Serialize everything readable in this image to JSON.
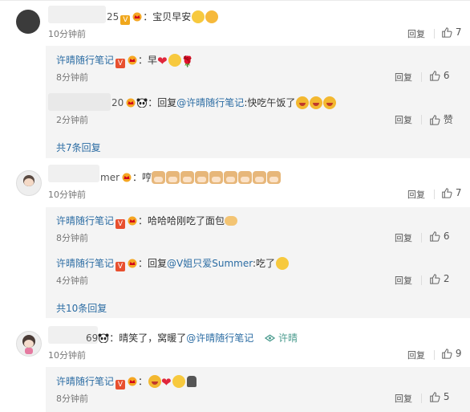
{
  "comments": [
    {
      "name_suffix": "25",
      "text": "：宝贝早安",
      "time": "10分钟前",
      "reply": "回复",
      "likes": "7",
      "replies": [
        {
          "name": "许晴随行笔记",
          "text": "：早",
          "time": "8分钟前",
          "reply": "回复",
          "likes": "6"
        },
        {
          "name_suffix": "20",
          "prefix": "：回复",
          "mention": "@许晴随行笔记",
          "text": ":快吃午饭了",
          "time": "2分钟前",
          "reply": "回复",
          "likes": "赞"
        }
      ],
      "more": "共7条回复"
    },
    {
      "name_suffix": "mer",
      "text": "：哼",
      "time": "10分钟前",
      "reply": "回复",
      "likes": "7",
      "replies": [
        {
          "name": "许晴随行笔记",
          "text": "：哈哈哈刚吃了面包",
          "time": "8分钟前",
          "reply": "回复",
          "likes": "6"
        },
        {
          "name": "许晴随行笔记",
          "prefix": "：回复",
          "mention": "@V姐只爱Summer",
          "text": ":吃了",
          "time": "4分钟前",
          "reply": "回复",
          "likes": "2"
        }
      ],
      "more": "共10条回复"
    },
    {
      "name_suffix": "69",
      "text": "：晴笑了，窝暖了",
      "mention": "@许晴随行笔记",
      "viewer": "许晴",
      "time": "10分钟前",
      "reply": "回复",
      "likes": "9",
      "replies": [
        {
          "name": "许晴随行笔记",
          "text": "：",
          "time": "8分钟前",
          "reply": "回复",
          "likes": "5"
        }
      ]
    }
  ],
  "colors": {
    "link": "#2b6ca3",
    "vip": "#e8502f",
    "heart": "#e0263b",
    "teal": "#4a9b8e"
  },
  "icons": [
    "thumb-up-icon",
    "vip-v-icon",
    "crown-icon",
    "panda-icon",
    "smile-emoji",
    "laugh-emoji",
    "heart-icon",
    "rose-icon",
    "cat-emoji",
    "eye-icon"
  ]
}
